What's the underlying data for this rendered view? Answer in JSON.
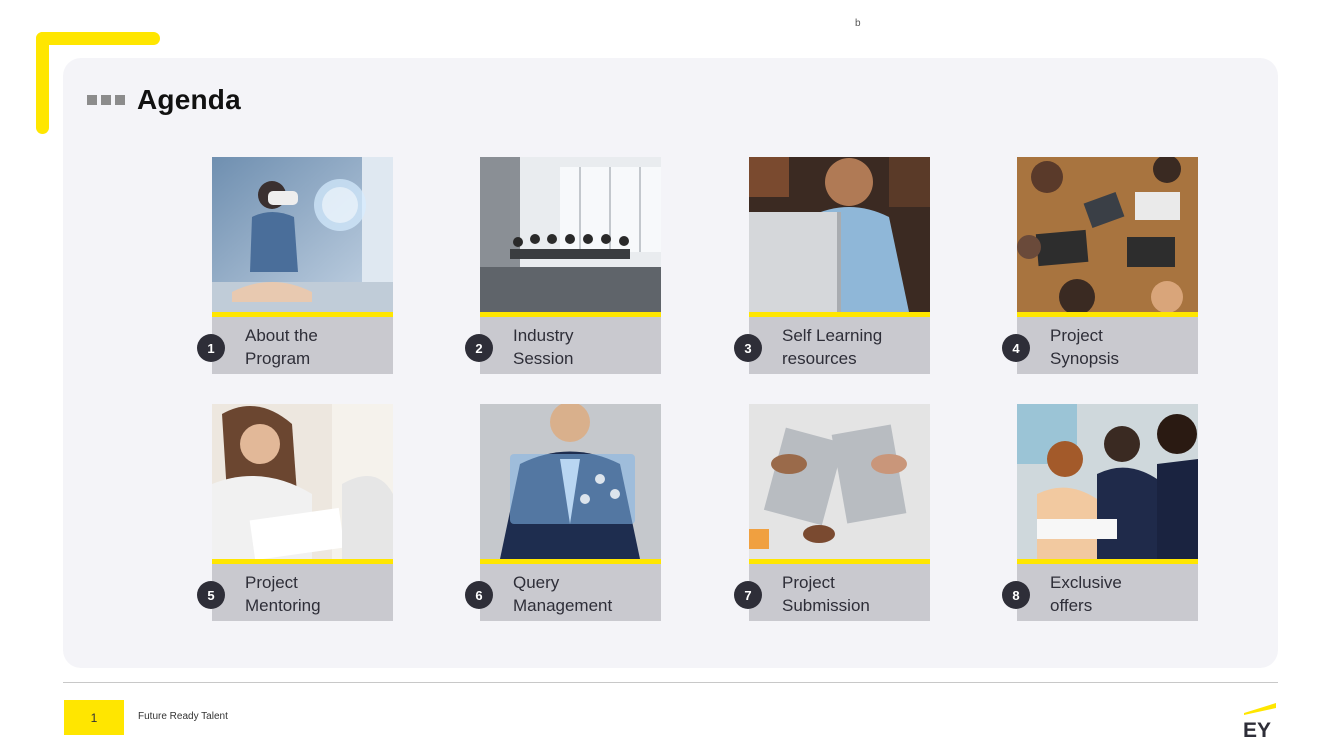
{
  "slide": {
    "title": "Agenda",
    "cursor_text": "b"
  },
  "cards": [
    {
      "number": "1",
      "label_line1": "About the",
      "label_line2": "Program",
      "image": "child-vr-headset-photo"
    },
    {
      "number": "2",
      "label_line1": "Industry",
      "label_line2": "Session",
      "image": "conference-room-meeting-photo"
    },
    {
      "number": "3",
      "label_line1": "Self Learning",
      "label_line2": "resources",
      "image": "man-laptop-smiling-photo"
    },
    {
      "number": "4",
      "label_line1": "Project",
      "label_line2": "Synopsis",
      "image": "team-laptops-table-photo"
    },
    {
      "number": "5",
      "label_line1": "Project",
      "label_line2": "Mentoring",
      "image": "woman-writing-documents-photo"
    },
    {
      "number": "6",
      "label_line1": "Query",
      "label_line2": "Management",
      "image": "businessman-virtual-screen-photo"
    },
    {
      "number": "7",
      "label_line1": "Project",
      "label_line2": "Submission",
      "image": "hands-typing-laptops-photo"
    },
    {
      "number": "8",
      "label_line1": "Exclusive",
      "label_line2": "offers",
      "image": "students-studying-photo"
    }
  ],
  "footer": {
    "page_number": "1",
    "text": "Future Ready Talent",
    "logo_text": "EY"
  },
  "colors": {
    "accent_yellow": "#FFE600",
    "dark": "#2e2e38",
    "label_bg": "#c9c9cf",
    "panel_bg": "#f4f4f8"
  }
}
